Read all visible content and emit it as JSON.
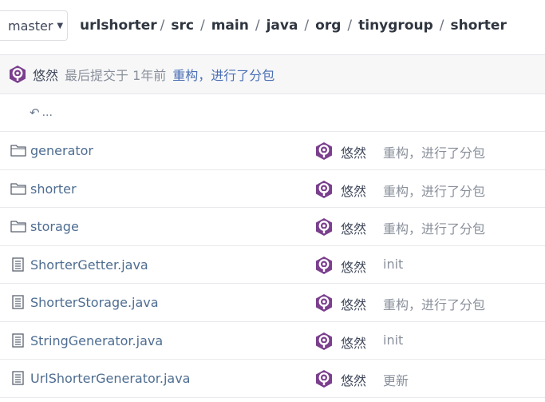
{
  "branch": {
    "name": "master"
  },
  "breadcrumb": [
    "urlshorter",
    "src",
    "main",
    "java",
    "org",
    "tinygroup",
    "shorter"
  ],
  "last_commit": {
    "author": "悠然",
    "info": "最后提交于 1年前",
    "message": "重构，进行了分包"
  },
  "parent_dir": {
    "label": "..."
  },
  "files": [
    {
      "type": "folder",
      "name": "generator",
      "author": "悠然",
      "message": "重构，进行了分包"
    },
    {
      "type": "folder",
      "name": "shorter",
      "author": "悠然",
      "message": "重构，进行了分包"
    },
    {
      "type": "folder",
      "name": "storage",
      "author": "悠然",
      "message": "重构，进行了分包"
    },
    {
      "type": "file",
      "name": "ShorterGetter.java",
      "author": "悠然",
      "message": "init"
    },
    {
      "type": "file",
      "name": "ShorterStorage.java",
      "author": "悠然",
      "message": "重构，进行了分包"
    },
    {
      "type": "file",
      "name": "StringGenerator.java",
      "author": "悠然",
      "message": "init"
    },
    {
      "type": "file",
      "name": "UrlShorterGenerator.java",
      "author": "悠然",
      "message": "更新"
    }
  ],
  "colors": {
    "avatar": "#7b3f8e",
    "link": "#4e6d91",
    "accent": "#4a6fb5"
  }
}
